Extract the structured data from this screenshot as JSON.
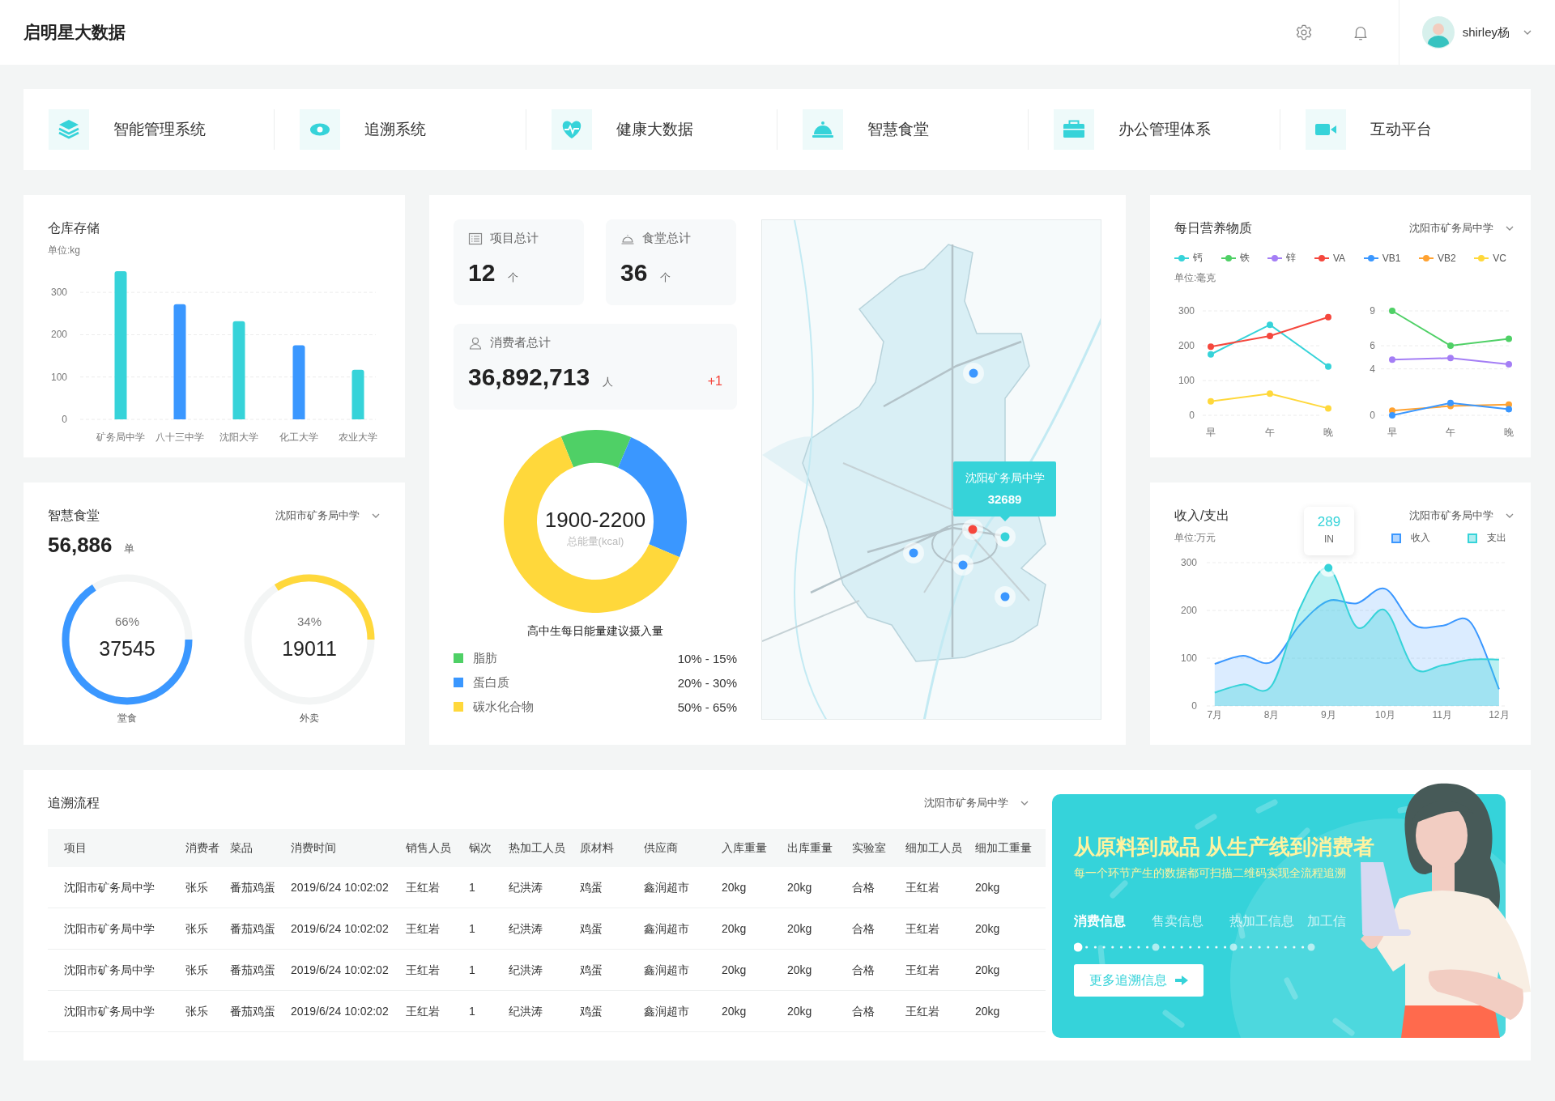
{
  "header": {
    "title": "启明星大数据",
    "user": "shirley杨"
  },
  "nav": [
    {
      "label": "智能管理系统"
    },
    {
      "label": "追溯系统"
    },
    {
      "label": "健康大数据"
    },
    {
      "label": "智慧食堂"
    },
    {
      "label": "办公管理体系"
    },
    {
      "label": "互动平台"
    }
  ],
  "warehouse": {
    "title": "仓库存储",
    "unit": "单位:kg",
    "chart_data": {
      "type": "bar",
      "categories": [
        "矿务局中学",
        "八十三中学",
        "沈阳大学",
        "化工大学",
        "农业大学"
      ],
      "values": [
        350,
        272,
        232,
        175,
        117
      ],
      "grid": true,
      "ylim": [
        0,
        350
      ],
      "yticks": [
        0,
        100,
        200,
        300
      ]
    }
  },
  "canteen": {
    "title": "智慧食堂",
    "selector": "沈阳市矿务局中学",
    "total": "56,886",
    "unit": "单",
    "rings": [
      {
        "percent": "66%",
        "value": "37545",
        "label": "堂食",
        "level": 0.66,
        "color": "#3a97ff"
      },
      {
        "percent": "34%",
        "value": "19011",
        "label": "外卖",
        "level": 0.34,
        "color": "#ffd83b"
      }
    ]
  },
  "stats": {
    "cards": [
      {
        "label": "项目总计",
        "value": "12",
        "unit": "个"
      },
      {
        "label": "食堂总计",
        "value": "36",
        "unit": "个"
      }
    ],
    "consumers": {
      "label": "消费者总计",
      "value": "36,892,713",
      "unit": "人",
      "delta": "+1"
    }
  },
  "energy": {
    "center_value": "1900-2200",
    "center_label": "总能量(kcal)",
    "title": "高中生每日能量建议摄入量",
    "chart_data": {
      "type": "donut",
      "values": [
        12.5,
        25,
        62.5
      ]
    },
    "legend": [
      {
        "label": "脂肪",
        "range": "10% - 15%",
        "color": "#4fd066"
      },
      {
        "label": "蛋白质",
        "range": "20% - 30%",
        "color": "#3a97ff"
      },
      {
        "label": "碳水化合物",
        "range": "50% - 65%",
        "color": "#ffd83b"
      }
    ]
  },
  "map": {
    "kind": "picture",
    "markers": [
      {
        "color": "#3a97ff"
      },
      {
        "color": "#f5473d"
      },
      {
        "color": "#36d3d9"
      },
      {
        "color": "#3a97ff"
      },
      {
        "color": "#3a97ff"
      },
      {
        "color": "#3a97ff"
      }
    ],
    "tooltip": {
      "title": "沈阳矿务局中学",
      "value": "32689"
    }
  },
  "nutrients": {
    "title": "每日营养物质",
    "selector": "沈阳市矿务局中学",
    "legend": [
      {
        "label": "钙",
        "color": "#36d3d9"
      },
      {
        "label": "铁",
        "color": "#4fd066"
      },
      {
        "label": "锌",
        "color": "#a47ef5"
      },
      {
        "label": "VA",
        "color": "#f5473d"
      },
      {
        "label": "VB1",
        "color": "#3a97ff"
      },
      {
        "label": "VB2",
        "color": "#ffa231"
      },
      {
        "label": "VC",
        "color": "#ffd83b"
      }
    ],
    "unit": "单位:毫克",
    "charts": [
      {
        "chart_data": {
          "type": "line",
          "categories": [
            "早",
            "午",
            "晚"
          ],
          "grid": true,
          "ylim": [
            0,
            300
          ],
          "yticks": [
            0,
            100,
            200,
            300
          ],
          "series": [
            {
              "color": "#36d3d9",
              "marker": "circle",
              "values": [
                175,
                260,
                140
              ]
            },
            {
              "color": "#f5473d",
              "marker": "circle",
              "values": [
                197,
                228,
                282
              ]
            },
            {
              "color": "#ffd83b",
              "marker": "circle",
              "values": [
                40,
                62,
                20
              ]
            }
          ]
        }
      },
      {
        "chart_data": {
          "type": "line",
          "categories": [
            "早",
            "午",
            "晚"
          ],
          "grid": true,
          "ylim": [
            0,
            9
          ],
          "yticks": [
            0,
            4,
            6,
            9
          ],
          "series": [
            {
              "color": "#4fd066",
              "marker": "circle",
              "values": [
                9,
                6,
                6.6
              ]
            },
            {
              "color": "#a47ef5",
              "marker": "circle",
              "values": [
                4.8,
                4.93,
                4.4
              ]
            },
            {
              "color": "#ffa231",
              "marker": "circle",
              "values": [
                0.4,
                0.8,
                0.93
              ]
            },
            {
              "color": "#3a97ff",
              "marker": "circle",
              "values": [
                0,
                1.07,
                0.53
              ]
            }
          ]
        }
      }
    ]
  },
  "finance": {
    "title": "收入/支出",
    "selector": "沈阳市矿务局中学",
    "unit": "单位:万元",
    "tooltip": {
      "value": "289",
      "label": "IN"
    },
    "chart_data": {
      "type": "area",
      "grid": true,
      "xlim": [
        6.86,
        12.13
      ],
      "ylim": [
        0,
        300
      ],
      "x": [
        7,
        7.5,
        8,
        8.5,
        9,
        9.5,
        10,
        10.5,
        11,
        11.5,
        12
      ],
      "xticks": [
        {
          "value": 7,
          "label": "7月"
        },
        {
          "value": 8,
          "label": "8月"
        },
        {
          "value": 9,
          "label": "9月"
        },
        {
          "value": 10,
          "label": "10月"
        },
        {
          "value": 11,
          "label": "11月"
        },
        {
          "value": 12,
          "label": "12月"
        }
      ],
      "yticks": [
        0,
        100,
        200,
        300
      ],
      "series": [
        {
          "name": "收入",
          "type": "area",
          "color": "#3a97ff",
          "values": [
            88,
            105,
            92,
            170,
            220,
            215,
            245,
            170,
            168,
            175,
            35
          ]
        },
        {
          "name": "支出",
          "type": "area",
          "color": "#36d3d9",
          "values": [
            28,
            45,
            42,
            205,
            289,
            165,
            200,
            80,
            85,
            97,
            97
          ]
        }
      ]
    }
  },
  "trace": {
    "title": "追溯流程",
    "selector": "沈阳市矿务局中学",
    "table": {
      "columns": [
        "项目",
        "消费者",
        "菜品",
        "消费时间",
        "销售人员",
        "锅次",
        "热加工人员",
        "原材料",
        "供应商",
        "入库重量",
        "出库重量",
        "实验室",
        "细加工人员",
        "细加工重量"
      ],
      "rows": [
        [
          "沈阳市矿务局中学",
          "张乐",
          "番茄鸡蛋",
          "2019/6/24 10:02:02",
          "王红岩",
          "1",
          "纪洪涛",
          "鸡蛋",
          "鑫润超市",
          "20kg",
          "20kg",
          "合格",
          "王红岩",
          "20kg"
        ],
        [
          "沈阳市矿务局中学",
          "张乐",
          "番茄鸡蛋",
          "2019/6/24 10:02:02",
          "王红岩",
          "1",
          "纪洪涛",
          "鸡蛋",
          "鑫润超市",
          "20kg",
          "20kg",
          "合格",
          "王红岩",
          "20kg"
        ],
        [
          "沈阳市矿务局中学",
          "张乐",
          "番茄鸡蛋",
          "2019/6/24 10:02:02",
          "王红岩",
          "1",
          "纪洪涛",
          "鸡蛋",
          "鑫润超市",
          "20kg",
          "20kg",
          "合格",
          "王红岩",
          "20kg"
        ],
        [
          "沈阳市矿务局中学",
          "张乐",
          "番茄鸡蛋",
          "2019/6/24 10:02:02",
          "王红岩",
          "1",
          "纪洪涛",
          "鸡蛋",
          "鑫润超市",
          "20kg",
          "20kg",
          "合格",
          "王红岩",
          "20kg"
        ]
      ]
    }
  },
  "banner": {
    "title": "从原料到成品 从生产线到消费者",
    "subtitle": "每一个环节产生的数据都可扫描二维码实现全流程追溯",
    "tabs": [
      {
        "label": "消费信息",
        "selected": true
      },
      {
        "label": "售卖信息",
        "selected": false
      },
      {
        "label": "热加工信息",
        "selected": false
      },
      {
        "label": "加工信",
        "selected": false
      }
    ],
    "button": "更多追溯信息"
  }
}
